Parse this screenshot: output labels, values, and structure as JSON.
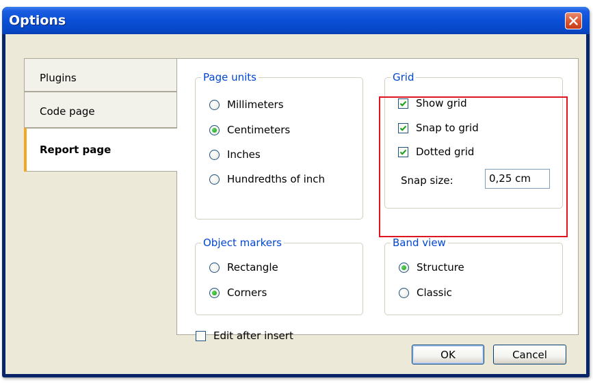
{
  "window": {
    "title": "Options"
  },
  "tabs": [
    {
      "label": "Plugins",
      "active": false
    },
    {
      "label": "Code page",
      "active": false
    },
    {
      "label": "Report page",
      "active": true
    }
  ],
  "page_units": {
    "legend": "Page units",
    "options": [
      "Millimeters",
      "Centimeters",
      "Inches",
      "Hundredths of inch"
    ],
    "selected": "Centimeters"
  },
  "grid": {
    "legend": "Grid",
    "show_grid": {
      "label": "Show grid",
      "checked": true
    },
    "snap_to_grid": {
      "label": "Snap to grid",
      "checked": true
    },
    "dotted_grid": {
      "label": "Dotted grid",
      "checked": true
    },
    "snap_size_label": "Snap size:",
    "snap_size_value": "0,25 cm"
  },
  "object_markers": {
    "legend": "Object markers",
    "options": [
      "Rectangle",
      "Corners"
    ],
    "selected": "Corners"
  },
  "band_view": {
    "legend": "Band view",
    "options": [
      "Structure",
      "Classic"
    ],
    "selected": "Structure"
  },
  "edit_after_insert": {
    "label": "Edit after insert",
    "checked": false
  },
  "buttons": {
    "ok": "OK",
    "cancel": "Cancel"
  },
  "colors": {
    "accent": "#0046d5",
    "tab_accent": "#f5a623",
    "highlight": "#e0141e",
    "titlebar": "#0a4fd6"
  }
}
